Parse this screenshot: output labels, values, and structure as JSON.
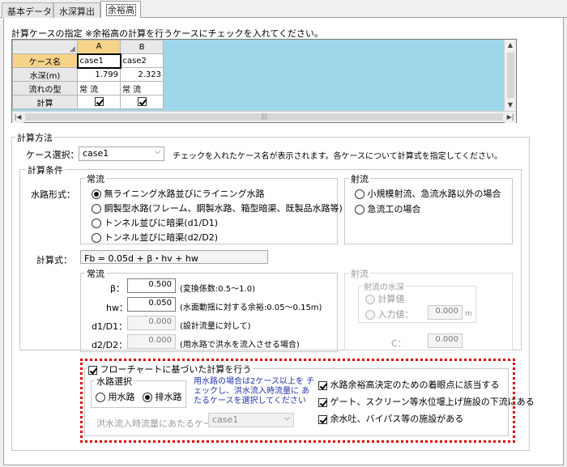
{
  "tabs": [
    {
      "label": "基本データ"
    },
    {
      "label": "水深算出"
    },
    {
      "label": "余裕高"
    }
  ],
  "case_section": {
    "title": "計算ケースの指定 ※余裕高の計算を行うケースにチェックを入れてください。",
    "columns": [
      "A",
      "B"
    ],
    "rows": [
      {
        "header": "ケース名",
        "values": [
          "case1",
          "case2"
        ]
      },
      {
        "header": "水深(m)",
        "values": [
          "1.799",
          "2.323"
        ]
      },
      {
        "header": "流れの型",
        "values": [
          "常 流",
          "常 流"
        ]
      },
      {
        "header": "計算",
        "checks": [
          true,
          true
        ]
      }
    ]
  },
  "method": {
    "title": "計算方法",
    "case_select_label": "ケース選択：",
    "case_select_value": "case1",
    "case_select_note": "チェックを入れたケース名が表示されます。各ケースについて計算式を指定してください。",
    "conditions_title": "計算条件",
    "channel_form_label": "水路形式：",
    "subcritical_title": "常流",
    "subcritical_options": [
      {
        "label": "無ライニング水路並びにライニング水路",
        "selected": true
      },
      {
        "label": "鋼製型水路(フレーム、鋼製水路、箱型暗渠、既製品水路等)",
        "selected": false
      },
      {
        "label": "トンネル並びに暗渠(d1/D1)",
        "selected": false
      },
      {
        "label": "トンネル並びに暗渠(d2/D2)",
        "selected": false
      }
    ],
    "supercritical_title": "射流",
    "supercritical_options": [
      {
        "label": "小規模射流、急流水路以外の場合",
        "selected": false
      },
      {
        "label": "急流工の場合",
        "selected": false
      }
    ],
    "formula_label": "計算式：",
    "formula": "Fb = 0.05d + β・hv + hw",
    "sub_params_title": "常流",
    "params": [
      {
        "label": "β：",
        "value": "0.500",
        "note": "(変換係数:0.5～1.0)",
        "enabled": true
      },
      {
        "label": "hw：",
        "value": "0.050",
        "note": "(水面動揺に対する余裕:0.05～0.15m)",
        "enabled": true
      },
      {
        "label": "d1/D1：",
        "value": "0.000",
        "note": "(設計流量に対して)",
        "enabled": false
      },
      {
        "label": "d2/D2：",
        "value": "0.000",
        "note": "(用水路で洪水を流入させる場合)",
        "enabled": false
      }
    ],
    "super_params_title": "射流",
    "water_depth_group": "射流の水深",
    "calc_value_label": "計算値",
    "input_value_label": "入力値：",
    "input_value": "0.000",
    "input_unit": "m",
    "c_label": "C：",
    "c_value": "0.000"
  },
  "flowchart": {
    "checkbox_label": "フローチャートに基づいた計算を行う",
    "checked": true,
    "channel_group_title": "水路選択",
    "channel_options": [
      {
        "label": "用水路",
        "selected": false
      },
      {
        "label": "排水路",
        "selected": true
      }
    ],
    "note": "用水路の場合は2ケース以上を チェックし、洪水流入時流量に あたるケースを選択してください",
    "flood_case_label": "洪水流入時流量にあたるケース：",
    "flood_case_value": "case1",
    "right_checks": [
      {
        "label": "水路余裕高決定のための着眼点に該当する",
        "checked": true
      },
      {
        "label": "ゲート、スクリーン等水位堰上げ施設の下流にある",
        "checked": true
      },
      {
        "label": "余水吐、バイパス等の施設がある",
        "checked": true
      }
    ]
  }
}
